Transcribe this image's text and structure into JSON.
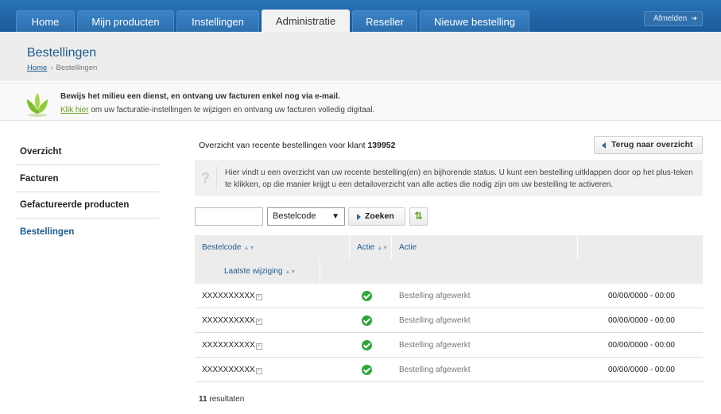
{
  "nav": {
    "tabs": [
      {
        "label": "Home"
      },
      {
        "label": "Mijn producten"
      },
      {
        "label": "Instellingen"
      },
      {
        "label": "Administratie",
        "active": true
      },
      {
        "label": "Reseller"
      },
      {
        "label": "Nieuwe bestelling"
      }
    ],
    "logout_label": "Afmelden"
  },
  "header": {
    "title": "Bestellingen",
    "breadcrumb": {
      "home": "Home",
      "current": "Bestellingen"
    }
  },
  "notice": {
    "title": "Bewijs het milieu een dienst, en ontvang uw facturen enkel nog via e-mail.",
    "link": "Klik hier",
    "text": "om uw facturatie-instellingen te wijzigen en ontvang uw facturen volledig digitaal."
  },
  "sidebar": {
    "items": [
      {
        "label": "Overzicht"
      },
      {
        "label": "Facturen"
      },
      {
        "label": "Gefactureerde producten"
      },
      {
        "label": "Bestellingen",
        "active": true
      }
    ]
  },
  "main": {
    "overview_prefix": "Overzicht van recente bestellingen voor klant",
    "customer_id": "139952",
    "back_label": "Terug naar overzicht",
    "info_text": "Hier vindt u een overzicht van uw recente bestelling(en) en bijhorende status. U kunt een bestelling uitklappen door op het plus-teken te klikken, op die manier krijgt u een detailoverzicht van alle acties die nodig zijn om uw bestelling te activeren.",
    "search_value": "",
    "select_value": "Bestelcode",
    "search_label": "Zoeken"
  },
  "table": {
    "headers": {
      "code": "Bestelcode",
      "action_icon": "Actie",
      "action": "Actie",
      "modified": "Laatste wijziging"
    },
    "rows": [
      {
        "code": "XXXXXXXXXX",
        "status": "Bestelling afgewerkt",
        "date": "00/00/0000 - 00:00"
      },
      {
        "code": "XXXXXXXXXX",
        "status": "Bestelling afgewerkt",
        "date": "00/00/0000 - 00:00"
      },
      {
        "code": "XXXXXXXXXX",
        "status": "Bestelling afgewerkt",
        "date": "00/00/0000 - 00:00"
      },
      {
        "code": "XXXXXXXXXX",
        "status": "Bestelling afgewerkt",
        "date": "00/00/0000 - 00:00"
      }
    ],
    "results_count": "11",
    "results_label": "resultaten"
  },
  "colors": {
    "brand_blue": "#1d5a8f",
    "nav_blue": "#2a74b8",
    "eco_green": "#6a9c1e",
    "check_green": "#2fa63a"
  }
}
